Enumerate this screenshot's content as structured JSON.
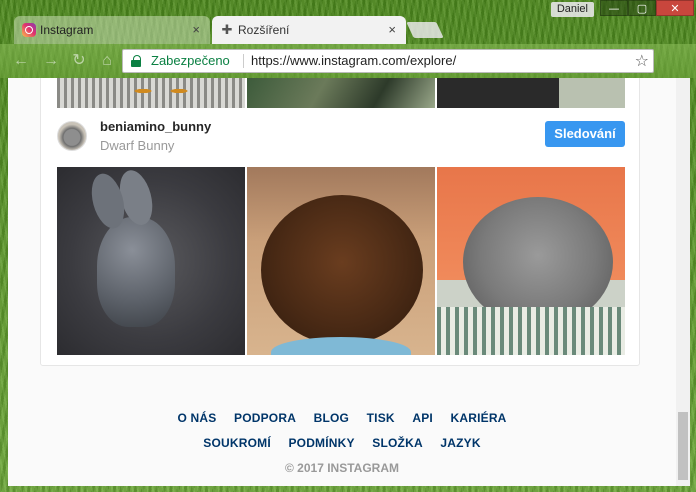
{
  "window": {
    "user": "Daniel",
    "buttons": [
      "—",
      "▢",
      "✕"
    ]
  },
  "tabs": [
    {
      "label": "Instagram",
      "icon": "instagram-icon",
      "close": "×"
    },
    {
      "label": "Rozšíření",
      "icon": "puzzle-icon",
      "close": "×"
    }
  ],
  "toolbar": {
    "back": "←",
    "forward": "→",
    "reload": "↻",
    "home": "⌂",
    "secure_label": "Zabezpečeno",
    "url_host": "https://www.instagram.com/explore/",
    "star": "☆"
  },
  "suggestion": {
    "username": "beniamino_bunny",
    "subtitle": "Dwarf Bunny",
    "follow_label": "Sledování"
  },
  "footer": {
    "row1": [
      "O NÁS",
      "PODPORA",
      "BLOG",
      "TISK",
      "API",
      "KARIÉRA"
    ],
    "row2": [
      "SOUKROMÍ",
      "PODMÍNKY",
      "SLOŽKA",
      "JAZYK"
    ],
    "copyright": "© 2017 INSTAGRAM"
  },
  "colors": {
    "accent": "#3897f0",
    "secure": "#0b8043",
    "link": "#003569"
  }
}
